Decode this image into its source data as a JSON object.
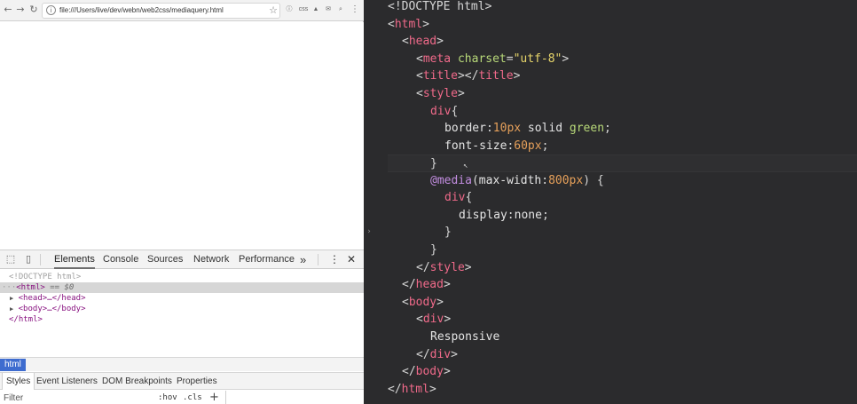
{
  "browser": {
    "nav": {
      "back": "←",
      "forward": "→",
      "reload": "↻"
    },
    "address": {
      "info": "i",
      "url": "file:///Users/live/dev/webn/web2css/mediaquery.html",
      "star": "☆"
    },
    "extensions": [
      "ⓘ",
      "css",
      "▲",
      "✉",
      "⌕",
      "⋮"
    ]
  },
  "devtools": {
    "tabs": [
      {
        "label": "Elements",
        "active": true
      },
      {
        "label": "Console"
      },
      {
        "label": "Sources"
      },
      {
        "label": "Network"
      },
      {
        "label": "Performance"
      }
    ],
    "more": "»",
    "menu": "⋮",
    "close": "✕",
    "dom": {
      "doctype": "<!DOCTYPE html>",
      "html_open": "<html>",
      "html_eq": "== $0",
      "head": "<head>…</head>",
      "body": "<body>…</body>",
      "html_close": "</html>"
    },
    "breadcrumb": "html",
    "subtabs": [
      {
        "label": "Styles",
        "active": true
      },
      {
        "label": "Event Listeners"
      },
      {
        "label": "DOM Breakpoints"
      },
      {
        "label": "Properties"
      }
    ],
    "filter": {
      "placeholder": "Filter",
      "hov": ":hov",
      "cls": ".cls",
      "add": "+"
    }
  },
  "editor": {
    "l1": "<!DOCTYPE html>",
    "html": "html",
    "head": "head",
    "meta": "meta",
    "charset": "charset",
    "utf8": "\"utf-8\"",
    "title": "title",
    "style": "style",
    "div": "div",
    "border": "border",
    "border_num": "10px",
    "border_rest": " solid ",
    "green": "green",
    "font_size": "font-size",
    "fs_num": "60px",
    "media": "@media",
    "max_width": "max-width",
    "mw_num": "800px",
    "display": "display",
    "none": "none",
    "body": "body",
    "responsive": "Responsive"
  }
}
